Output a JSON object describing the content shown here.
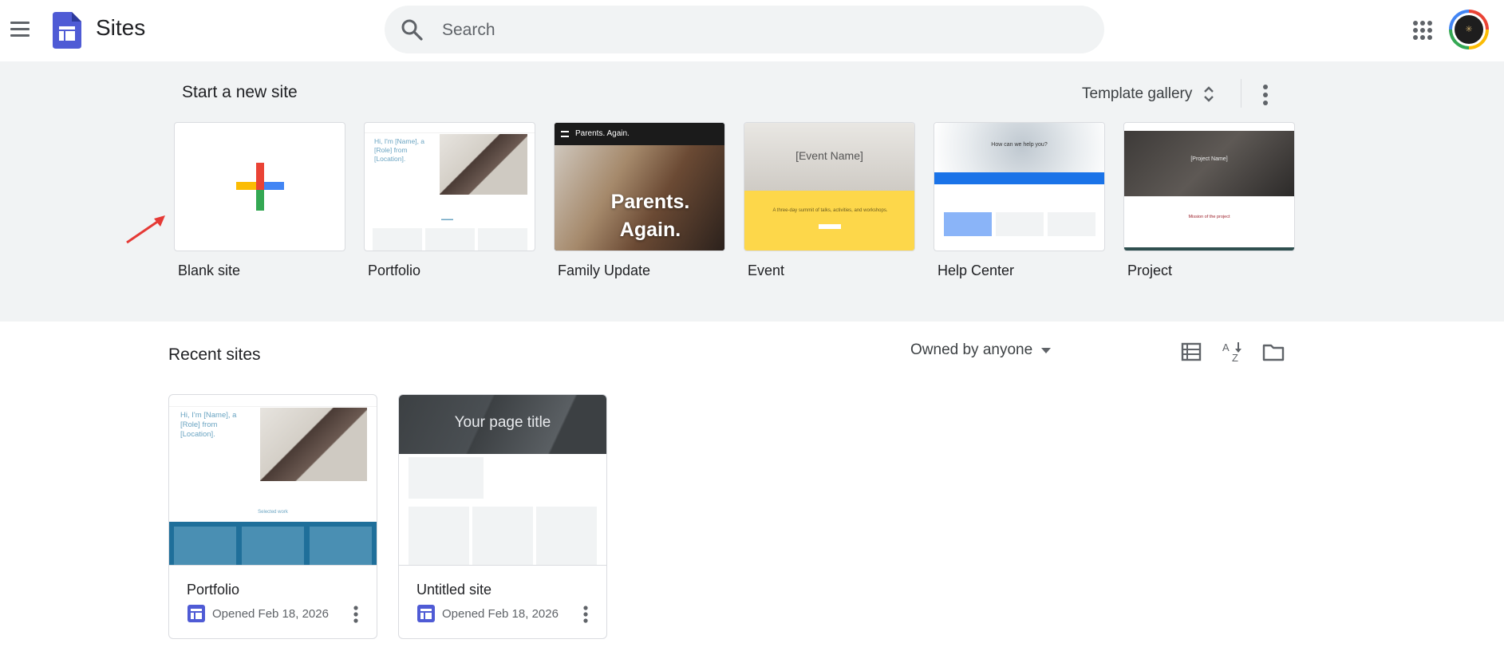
{
  "header": {
    "app_title": "Sites",
    "search_placeholder": "Search"
  },
  "new_site": {
    "heading": "Start a new site",
    "template_gallery_label": "Template gallery",
    "templates": [
      {
        "label": "Blank site"
      },
      {
        "label": "Portfolio",
        "thumb_text": "Hi, I'm [Name], a [Role] from [Location]."
      },
      {
        "label": "Family Update",
        "thumb_header": "Parents. Again.",
        "thumb_overlay": "Parents. Again."
      },
      {
        "label": "Event",
        "thumb_title": "[Event Name]",
        "thumb_tagline": "A three-day summit of talks, activities, and workshops."
      },
      {
        "label": "Help Center",
        "thumb_question": "How can we help you?"
      },
      {
        "label": "Project",
        "thumb_title": "[Project Name]",
        "thumb_mission": "Mission of the project"
      }
    ]
  },
  "recent": {
    "heading": "Recent sites",
    "owner_filter": "Owned by anyone",
    "sites": [
      {
        "name": "Portfolio",
        "meta": "Opened Feb 18, 2026",
        "thumb_text": "Hi, I'm [Name], a [Role] from [Location].",
        "thumb_caption": "Selected work"
      },
      {
        "name": "Untitled site",
        "meta": "Opened Feb 18, 2026",
        "thumb_title": "Your page title"
      }
    ]
  },
  "icons": {
    "menu": "hamburger-menu-icon",
    "search": "search-icon",
    "apps": "apps-grid-icon",
    "sort": "unfold-more-icon",
    "more": "more-vert-icon",
    "list_view": "list-view-icon",
    "sort_az": "sort-az-icon",
    "folder": "folder-icon",
    "site": "sites-file-icon"
  },
  "colors": {
    "brand": "#4f5bd5",
    "plus_red": "#ea4335",
    "plus_yellow": "#fbbc04",
    "plus_green": "#34a853",
    "plus_blue": "#4285f4",
    "annotation_arrow": "#e53935"
  }
}
